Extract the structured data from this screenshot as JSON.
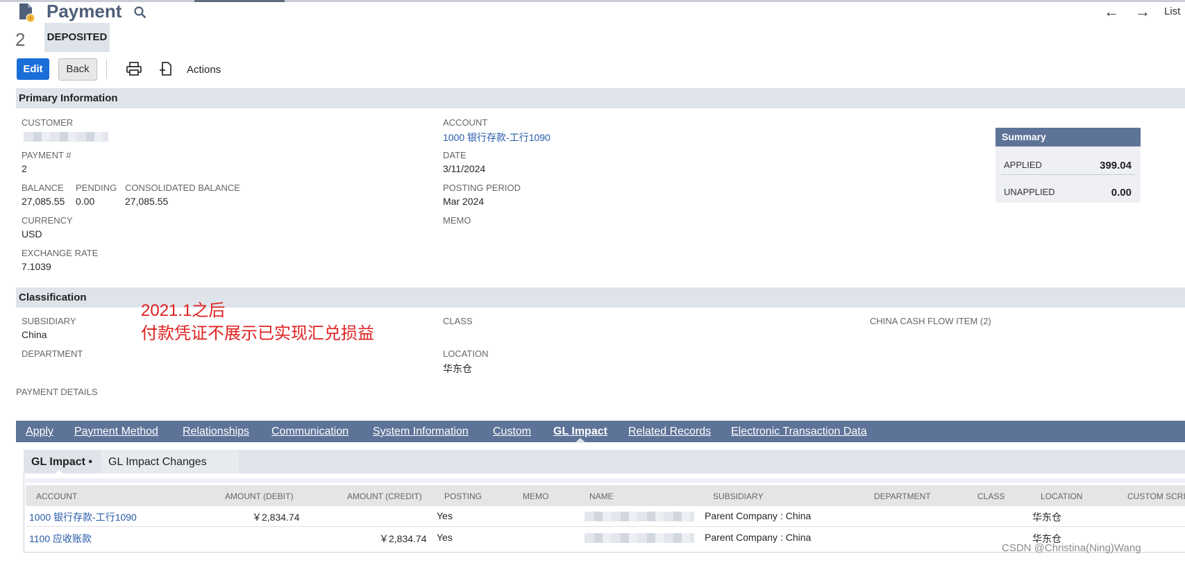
{
  "header": {
    "title": "Payment",
    "nav_list": "List",
    "record_number": "2",
    "status": "DEPOSITED"
  },
  "toolbar": {
    "edit_label": "Edit",
    "back_label": "Back",
    "actions_label": "Actions"
  },
  "primary": {
    "section_title": "Primary Information",
    "customer_label": "CUSTOMER",
    "payment_no_label": "PAYMENT #",
    "payment_no": "2",
    "balance_label": "BALANCE",
    "balance": "27,085.55",
    "pending_label": "PENDING",
    "pending": "0.00",
    "consolidated_label": "CONSOLIDATED BALANCE",
    "consolidated": "27,085.55",
    "currency_label": "CURRENCY",
    "currency": "USD",
    "exchange_label": "EXCHANGE RATE",
    "exchange": "7.1039",
    "account_label": "ACCOUNT",
    "account": "1000 银行存款-工行1090",
    "date_label": "DATE",
    "date": "3/11/2024",
    "posting_period_label": "POSTING PERIOD",
    "posting_period": "Mar 2024",
    "memo_label": "MEMO"
  },
  "summary": {
    "title": "Summary",
    "applied_label": "APPLIED",
    "applied": "399.04",
    "unapplied_label": "UNAPPLIED",
    "unapplied": "0.00"
  },
  "classification": {
    "section_title": "Classification",
    "subsidiary_label": "SUBSIDIARY",
    "subsidiary": "China",
    "department_label": "DEPARTMENT",
    "class_label": "CLASS",
    "location_label": "LOCATION",
    "location": "华东仓",
    "cashflow_label": "CHINA CASH FLOW ITEM (2)"
  },
  "annotation": {
    "line1": "2021.1之后",
    "line2": "付款凭证不展示已实现汇兑损益"
  },
  "payment_details_label": "PAYMENT DETAILS",
  "subtabs": [
    "Apply",
    "Payment Method",
    "Relationships",
    "Communication",
    "System Information",
    "Custom",
    "GL Impact",
    "Related Records",
    "Electronic Transaction Data"
  ],
  "inner_tabs": {
    "gl_impact": "GL Impact •",
    "gl_changes": "GL Impact Changes"
  },
  "table": {
    "headers": [
      "ACCOUNT",
      "AMOUNT (DEBIT)",
      "AMOUNT (CREDIT)",
      "POSTING",
      "MEMO",
      "NAME",
      "SUBSIDIARY",
      "DEPARTMENT",
      "CLASS",
      "LOCATION",
      "CUSTOM SCRI"
    ],
    "rows": [
      {
        "account": "1000 银行存款-工行1090",
        "debit": "￥2,834.74",
        "credit": "",
        "posting": "Yes",
        "subsidiary": "Parent Company : China",
        "location": "华东仓"
      },
      {
        "account": "1100 应收账款",
        "debit": "",
        "credit": "￥2,834.74",
        "posting": "Yes",
        "subsidiary": "Parent Company : China",
        "location": "华东仓"
      }
    ]
  },
  "watermark": "CSDN @Christina(Ning)Wang"
}
